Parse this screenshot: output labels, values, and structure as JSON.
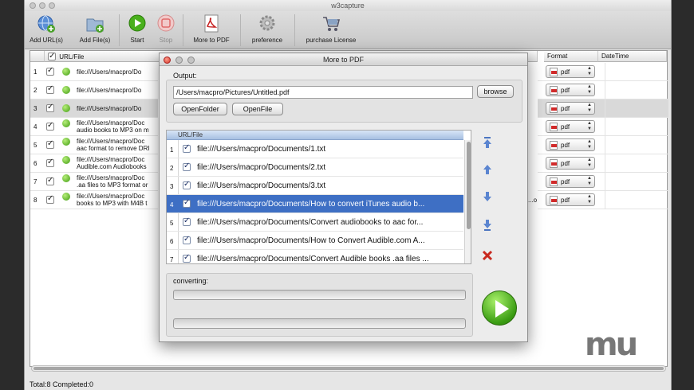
{
  "app": {
    "title": "w3capture"
  },
  "toolbar": {
    "add_urls": "Add URL(s)",
    "add_files": "Add File(s)",
    "start": "Start",
    "stop": "Stop",
    "more_to_pdf": "More to PDF",
    "preference": "preference",
    "purchase": "purchase License"
  },
  "table": {
    "columns": {
      "url_file": "URL/File",
      "format": "Format",
      "datetime": "DateTime"
    },
    "rows": [
      {
        "num": "1",
        "line1": "file:///Users/macpro/Do",
        "line2": ""
      },
      {
        "num": "2",
        "line1": "file:///Users/macpro/Do",
        "line2": ""
      },
      {
        "num": "3",
        "line1": "file:///Users/macpro/Do",
        "line2": ""
      },
      {
        "num": "4",
        "line1": "file:///Users/macpro/Doc",
        "line2": "audio books to MP3 on m"
      },
      {
        "num": "5",
        "line1": "file:///Users/macpro/Doc",
        "line2": "aac format to remove DRI"
      },
      {
        "num": "6",
        "line1": "file:///Users/macpro/Doc",
        "line2": "Audible.com Audiobooks"
      },
      {
        "num": "7",
        "line1": "file:///Users/macpro/Doc",
        "line2": ".aa files to MP3 format or"
      },
      {
        "num": "8",
        "line1": "file:///Users/macpro/Doc",
        "line2": "books to MP3 with M4B t"
      }
    ],
    "format_value": "pdf",
    "partial_cell": "...o"
  },
  "status": {
    "text": "Total:8  Completed:0"
  },
  "dialog": {
    "title": "More to PDF",
    "output_label": "Output:",
    "output_path": "/Users/macpro/Pictures/Untitled.pdf",
    "browse": "browse",
    "open_folder": "OpenFolder",
    "open_file": "OpenFile",
    "list_header": "URL/File",
    "items": [
      {
        "num": "1",
        "text": "file:///Users/macpro/Documents/1.txt"
      },
      {
        "num": "2",
        "text": "file:///Users/macpro/Documents/2.txt"
      },
      {
        "num": "3",
        "text": "file:///Users/macpro/Documents/3.txt"
      },
      {
        "num": "4",
        "text": "file:///Users/macpro/Documents/How to convert iTunes audio b..."
      },
      {
        "num": "5",
        "text": "file:///Users/macpro/Documents/Convert audiobooks to aac for..."
      },
      {
        "num": "6",
        "text": "file:///Users/macpro/Documents/How to Convert Audible.com A..."
      },
      {
        "num": "7",
        "text": "file:///Users/macpro/Documents/Convert Audible books .aa files ..."
      }
    ],
    "converting_label": "converting:"
  },
  "watermark": {
    "text": "mu"
  },
  "colors": {
    "selection": "#3e6fc4",
    "go_green": "#3a9c12",
    "pdf_red": "#d12a2a"
  }
}
